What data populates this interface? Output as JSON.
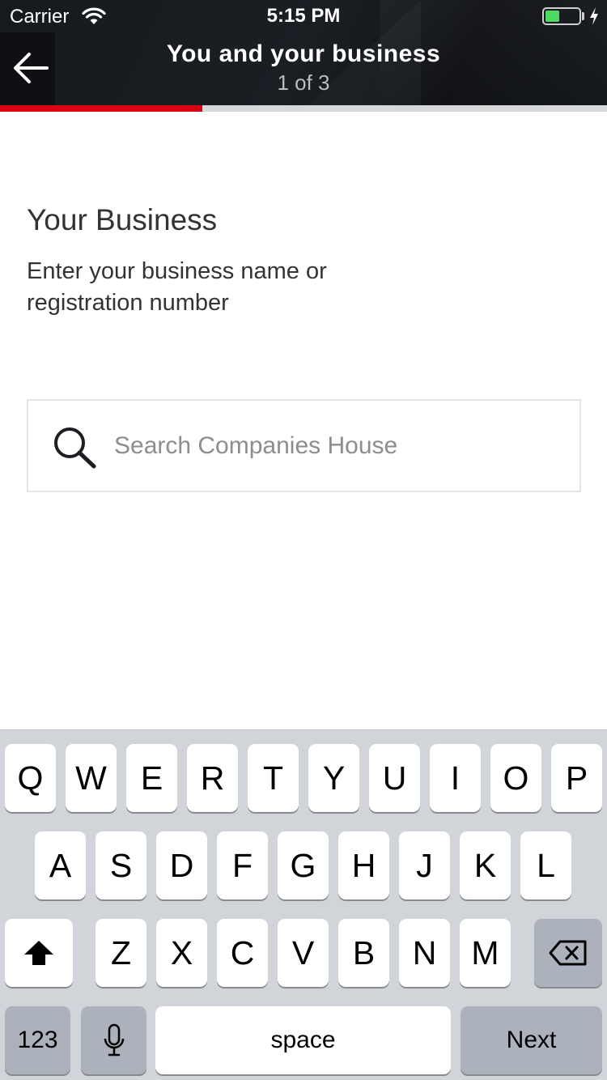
{
  "status_bar": {
    "carrier": "Carrier",
    "time": "5:15 PM",
    "battery_level": 0.42,
    "battery_color": "#4cd964"
  },
  "header": {
    "title": "You and your business",
    "step": "1 of 3",
    "back_icon": "arrow-left-icon"
  },
  "progress": {
    "fraction": 0.333,
    "color": "#db0011"
  },
  "main": {
    "section_title": "Your Business",
    "section_description": "Enter your business name or registration number"
  },
  "search": {
    "placeholder": "Search Companies House",
    "value": "",
    "icon": "search-icon"
  },
  "keyboard": {
    "row1": [
      "Q",
      "W",
      "E",
      "R",
      "T",
      "Y",
      "U",
      "I",
      "O",
      "P"
    ],
    "row2": [
      "A",
      "S",
      "D",
      "F",
      "G",
      "H",
      "J",
      "K",
      "L"
    ],
    "row3": [
      "Z",
      "X",
      "C",
      "V",
      "B",
      "N",
      "M"
    ],
    "shift_icon": "shift-icon",
    "delete_icon": "delete-icon",
    "numbers_label": "123",
    "mic_icon": "microphone-icon",
    "space_label": "space",
    "return_label": "Next"
  }
}
